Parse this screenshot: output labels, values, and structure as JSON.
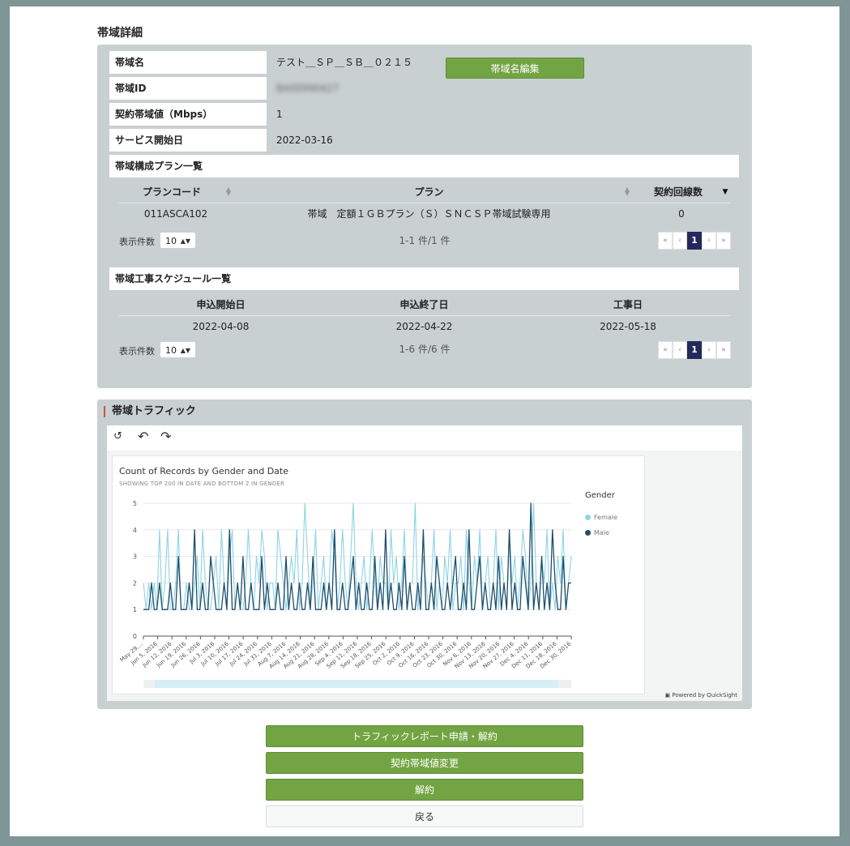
{
  "page_title": "帯域詳細",
  "details": {
    "name_label": "帯域名",
    "name_value": "テスト＿ＳＰ＿ＳＢ＿０２１５",
    "edit_button": "帯域名編集",
    "id_label": "帯域ID",
    "id_value": "BA00990427",
    "bandwidth_label": "契約帯域値（Mbps）",
    "bandwidth_value": "1",
    "start_label": "サービス開始日",
    "start_value": "2022-03-16"
  },
  "plans": {
    "heading": "帯域構成プラン一覧",
    "columns": [
      "プランコード",
      "プラン",
      "契約回線数"
    ],
    "rows": [
      [
        "011ASCA102",
        "帯域　定額１ＧＢプラン（Ｓ）ＳＮＣＳＰ帯域試験専用",
        "0"
      ]
    ],
    "page_size_label": "表示件数",
    "page_size": "10",
    "count_text": "1-1 件/1 件",
    "pager": [
      "«",
      "‹",
      "1",
      "›",
      "»"
    ]
  },
  "schedule": {
    "heading": "帯域工事スケジュール一覧",
    "columns": [
      "申込開始日",
      "申込終了日",
      "工事日"
    ],
    "rows": [
      [
        "2022-04-08",
        "2022-04-22",
        "2022-05-18"
      ]
    ],
    "page_size_label": "表示件数",
    "page_size": "10",
    "count_text": "1-6 件/6 件",
    "pager": [
      "«",
      "‹",
      "1",
      "›",
      "»"
    ]
  },
  "traffic": {
    "heading": "帯域トラフィック",
    "powered_by": "Powered by QuickSight"
  },
  "colors": {
    "female": "#8ed3e6",
    "male": "#1f4e6b",
    "green_button": "#73a443",
    "pager_active": "#222a5c"
  },
  "chart_data": {
    "type": "line",
    "title": "Count of Records by Gender and Date",
    "subtitle": "SHOWING TOP 200 IN DATE AND BOTTOM 2 IN GENDER",
    "legend_title": "Gender",
    "legend_position": "right",
    "ylim": [
      0,
      5
    ],
    "yticks": [
      "0",
      "1",
      "2",
      "3",
      "4",
      "5"
    ],
    "xticks": [
      "May 29,...",
      "Jun 5, 2016",
      "Jun 12, 2016",
      "Jun 19, 2016",
      "Jun 26, 2016",
      "Jul 3, 2016",
      "Jul 10, 2016",
      "Jul 17, 2016",
      "Jul 24, 2016",
      "Jul 31, 2016",
      "Aug 7, 2016",
      "Aug 14, 2016",
      "Aug 21, 2016",
      "Aug 28, 2016",
      "Sep 4, 2016",
      "Sep 11, 2016",
      "Sep 18, 2016",
      "Sep 25, 2016",
      "Oct 2, 2016",
      "Oct 9, 2016",
      "Oct 16, 2016",
      "Oct 23, 2016",
      "Oct 30, 2016",
      "Nov 6, 2016",
      "Nov 13, 2016",
      "Nov 20, 2016",
      "Nov 27, 2016",
      "Dec 4, 2016",
      "Dec 11, 2016",
      "Dec 18, 2016",
      "Dec 30, 2016"
    ],
    "series": [
      {
        "name": "Female",
        "values": [
          2,
          1,
          2,
          1,
          2,
          1,
          4,
          1,
          2,
          4,
          1,
          1,
          2,
          4,
          1,
          1,
          2,
          1,
          1,
          2,
          3,
          1,
          4,
          2,
          1,
          1,
          2,
          3,
          1,
          4,
          2,
          1,
          3,
          4,
          1,
          2,
          1,
          1,
          2,
          4,
          2,
          1,
          3,
          2,
          4,
          3,
          1,
          2,
          2,
          1,
          4,
          3,
          2,
          1,
          2,
          3,
          2,
          4,
          1,
          2,
          5,
          3,
          1,
          2,
          4,
          1,
          2,
          3,
          1,
          2,
          4,
          3,
          1,
          2,
          4,
          2,
          1,
          3,
          5,
          2,
          1,
          2,
          3,
          1,
          2,
          4,
          2,
          1,
          3,
          2,
          2,
          1,
          4,
          2,
          3,
          1,
          2,
          4,
          1,
          2,
          2,
          5,
          1,
          2,
          3,
          2,
          1,
          2,
          4,
          1,
          2,
          1,
          3,
          2,
          4,
          1,
          2,
          2,
          3,
          1,
          4,
          2,
          1,
          3,
          2,
          4,
          1,
          2,
          3,
          1,
          2,
          4,
          1,
          3,
          2,
          1,
          4,
          2,
          3,
          1,
          2,
          4,
          3,
          1,
          2,
          5,
          2,
          1,
          3,
          2,
          4,
          1,
          2,
          1,
          3,
          2,
          4,
          1,
          2,
          3
        ]
      },
      {
        "name": "Male",
        "values": [
          1,
          1,
          1,
          2,
          1,
          1,
          2,
          1,
          1,
          1,
          2,
          1,
          1,
          3,
          1,
          1,
          1,
          2,
          1,
          4,
          1,
          1,
          2,
          1,
          1,
          3,
          2,
          1,
          1,
          1,
          2,
          1,
          4,
          1,
          1,
          2,
          1,
          3,
          1,
          1,
          2,
          1,
          1,
          1,
          3,
          1,
          2,
          1,
          1,
          1,
          2,
          1,
          1,
          3,
          1,
          2,
          1,
          1,
          2,
          1,
          1,
          2,
          1,
          3,
          1,
          1,
          1,
          2,
          1,
          2,
          1,
          4,
          1,
          1,
          2,
          1,
          1,
          2,
          3,
          1,
          2,
          1,
          1,
          2,
          1,
          1,
          3,
          1,
          2,
          1,
          4,
          1,
          2,
          1,
          1,
          2,
          1,
          3,
          1,
          2,
          1,
          1,
          2,
          1,
          4,
          1,
          1,
          2,
          1,
          3,
          2,
          1,
          1,
          2,
          1,
          2,
          3,
          1,
          1,
          2,
          1,
          4,
          1,
          1,
          2,
          3,
          1,
          2,
          1,
          1,
          2,
          1,
          3,
          1,
          2,
          1,
          4,
          1,
          2,
          1,
          1,
          3,
          2,
          1,
          5,
          1,
          2,
          1,
          3,
          1,
          2,
          1,
          4,
          2,
          1,
          1,
          3,
          1,
          2,
          2
        ]
      }
    ]
  }
}
